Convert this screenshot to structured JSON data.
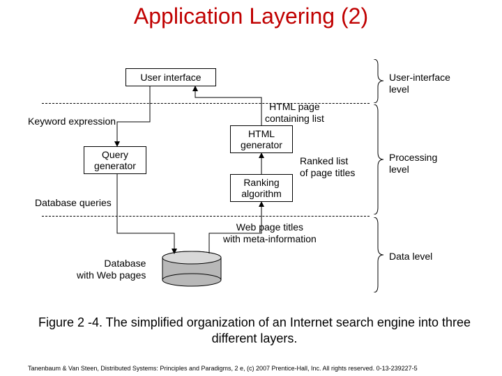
{
  "title": "Application Layering (2)",
  "boxes": {
    "user_interface": "User interface",
    "html_generator": "HTML\ngenerator",
    "query_generator": "Query\ngenerator",
    "ranking_algorithm": "Ranking\nalgorithm"
  },
  "labels": {
    "keyword_expression": "Keyword expression",
    "html_page": "HTML page\ncontaining list",
    "ranked_list": "Ranked list\nof page titles",
    "database_queries": "Database queries",
    "web_page_titles": "Web page titles\nwith meta-information",
    "database_with_web_pages": "Database\nwith Web pages"
  },
  "levels": {
    "ui": "User-interface\nlevel",
    "processing": "Processing\nlevel",
    "data": "Data level"
  },
  "caption": "Figure 2 -4. The simplified organization of an Internet search engine into three different layers.",
  "footer": "Tanenbaum & Van Steen, Distributed Systems: Principles and Paradigms, 2 e, (c) 2007 Prentice-Hall, Inc. All rights reserved. 0-13-239227-5"
}
